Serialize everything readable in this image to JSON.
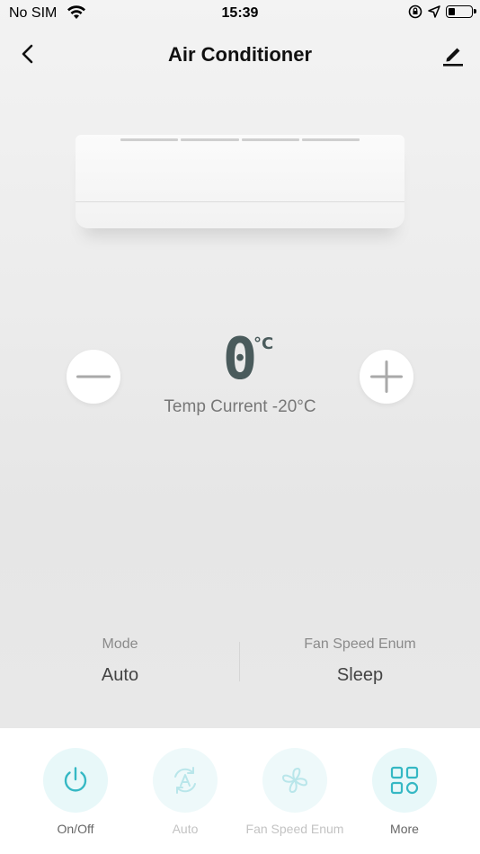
{
  "status_bar": {
    "carrier": "No SIM",
    "time": "15:39",
    "battery_level": 0.3
  },
  "nav": {
    "title": "Air Conditioner",
    "icons": [
      "back-chevron-icon",
      "edit-pencil-icon"
    ]
  },
  "temperature": {
    "set_value": "0",
    "unit": "°C",
    "current_label": "Temp Current -20°C"
  },
  "info": {
    "mode_label": "Mode",
    "mode_value": "Auto",
    "fan_label": "Fan Speed Enum",
    "fan_value": "Sleep"
  },
  "actions": [
    {
      "label": "On/Off",
      "icon": "power-icon",
      "enabled": true
    },
    {
      "label": "Auto",
      "icon": "auto-mode-icon",
      "enabled": false
    },
    {
      "label": "Fan Speed Enum",
      "icon": "fan-icon",
      "enabled": false
    },
    {
      "label": "More",
      "icon": "grid-icon",
      "enabled": true
    }
  ],
  "colors": {
    "accent": "#35b8c4",
    "accent_disabled": "#b9e6ea",
    "temp_text": "#4a5b5c"
  }
}
